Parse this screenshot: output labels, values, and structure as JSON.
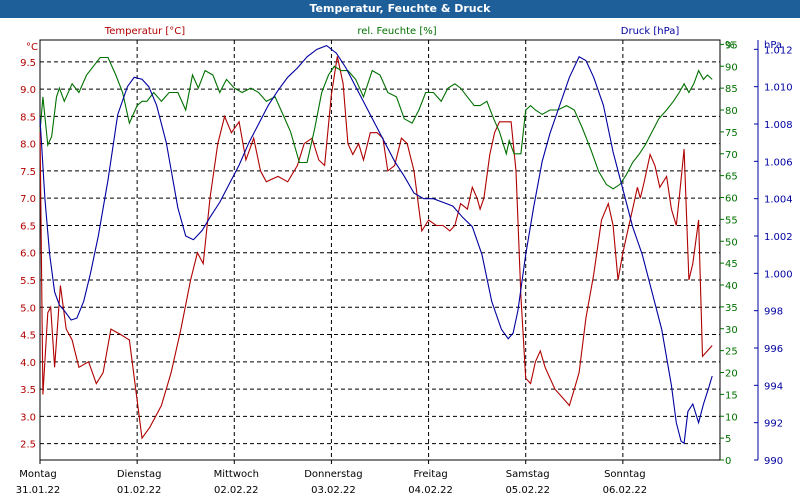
{
  "window_title": "Temperatur, Feuchte & Druck",
  "colors": {
    "temperature": "#b00000",
    "humidity": "#007000",
    "pressure": "#0000a0",
    "title_bg": "#1f5f99"
  },
  "chart_data": {
    "type": "line",
    "title": "Temperatur, Feuchte & Druck",
    "grid": true,
    "x_ticks": [
      {
        "day": "Montag",
        "date": "31.01.22"
      },
      {
        "day": "Dienstag",
        "date": "01.02.22"
      },
      {
        "day": "Mittwoch",
        "date": "02.02.22"
      },
      {
        "day": "Donnerstag",
        "date": "03.02.22"
      },
      {
        "day": "Freitag",
        "date": "04.02.22"
      },
      {
        "day": "Samstag",
        "date": "05.02.22"
      },
      {
        "day": "Sonntag",
        "date": "06.02.22"
      }
    ],
    "x_unit": "days since Montag 31.01.22 00:00",
    "axes": {
      "temperature": {
        "unit": "°C",
        "label": "Temperatur [°C]",
        "range": [
          2.2,
          9.9
        ],
        "ticks": [
          "2.5",
          "3.0",
          "3.5",
          "4.0",
          "4.5",
          "5.0",
          "5.5",
          "6.0",
          "6.5",
          "7.0",
          "7.5",
          "8.0",
          "8.5",
          "9.0",
          "9.5"
        ]
      },
      "humidity": {
        "unit": "%",
        "label": "rel. Feuchte [%]",
        "range": [
          0,
          96
        ],
        "ticks": [
          "0",
          "5",
          "10",
          "15",
          "20",
          "25",
          "30",
          "35",
          "40",
          "45",
          "50",
          "55",
          "60",
          "65",
          "70",
          "75",
          "80",
          "85",
          "90",
          "95"
        ]
      },
      "pressure": {
        "unit": "hPa",
        "label": "Druck [hPa]",
        "range": [
          990,
          1012.5
        ],
        "ticks": [
          "990",
          "992",
          "994",
          "996",
          "998",
          "1.000",
          "1.002",
          "1.004",
          "1.006",
          "1.008",
          "1.010",
          "1.012"
        ]
      }
    },
    "series": [
      {
        "name": "Temperatur [°C]",
        "axis": "temperature",
        "points": [
          [
            0,
            8.3
          ],
          [
            0.03,
            3.4
          ],
          [
            0.08,
            4.9
          ],
          [
            0.11,
            5.0
          ],
          [
            0.15,
            3.9
          ],
          [
            0.21,
            5.4
          ],
          [
            0.27,
            4.6
          ],
          [
            0.33,
            4.4
          ],
          [
            0.4,
            3.9
          ],
          [
            0.5,
            4.0
          ],
          [
            0.58,
            3.6
          ],
          [
            0.65,
            3.8
          ],
          [
            0.73,
            4.6
          ],
          [
            0.83,
            4.5
          ],
          [
            0.92,
            4.4
          ],
          [
            1.0,
            3.3
          ],
          [
            1.05,
            2.6
          ],
          [
            1.13,
            2.8
          ],
          [
            1.25,
            3.2
          ],
          [
            1.35,
            3.8
          ],
          [
            1.45,
            4.6
          ],
          [
            1.55,
            5.5
          ],
          [
            1.62,
            6.0
          ],
          [
            1.68,
            5.8
          ],
          [
            1.75,
            7.0
          ],
          [
            1.83,
            8.0
          ],
          [
            1.9,
            8.5
          ],
          [
            1.97,
            8.2
          ],
          [
            2.05,
            8.4
          ],
          [
            2.12,
            7.7
          ],
          [
            2.2,
            8.1
          ],
          [
            2.27,
            7.5
          ],
          [
            2.33,
            7.3
          ],
          [
            2.45,
            7.4
          ],
          [
            2.55,
            7.3
          ],
          [
            2.65,
            7.6
          ],
          [
            2.72,
            8.0
          ],
          [
            2.8,
            8.1
          ],
          [
            2.87,
            7.7
          ],
          [
            2.93,
            7.6
          ],
          [
            3.0,
            8.9
          ],
          [
            3.06,
            9.6
          ],
          [
            3.12,
            9.1
          ],
          [
            3.17,
            8.0
          ],
          [
            3.22,
            7.8
          ],
          [
            3.28,
            8.0
          ],
          [
            3.33,
            7.7
          ],
          [
            3.4,
            8.2
          ],
          [
            3.47,
            8.2
          ],
          [
            3.53,
            8.1
          ],
          [
            3.58,
            7.5
          ],
          [
            3.65,
            7.6
          ],
          [
            3.72,
            8.1
          ],
          [
            3.78,
            8.0
          ],
          [
            3.85,
            7.5
          ],
          [
            3.93,
            6.4
          ],
          [
            4.0,
            6.6
          ],
          [
            4.08,
            6.5
          ],
          [
            4.15,
            6.5
          ],
          [
            4.22,
            6.4
          ],
          [
            4.27,
            6.5
          ],
          [
            4.33,
            6.9
          ],
          [
            4.4,
            6.8
          ],
          [
            4.45,
            7.2
          ],
          [
            4.5,
            7.0
          ],
          [
            4.53,
            6.8
          ],
          [
            4.57,
            7.0
          ],
          [
            4.63,
            7.8
          ],
          [
            4.68,
            8.2
          ],
          [
            4.73,
            8.4
          ],
          [
            4.78,
            8.4
          ],
          [
            4.85,
            8.4
          ],
          [
            4.9,
            7.5
          ],
          [
            4.95,
            5.2
          ],
          [
            5.0,
            3.7
          ],
          [
            5.05,
            3.6
          ],
          [
            5.1,
            4.0
          ],
          [
            5.15,
            4.2
          ],
          [
            5.2,
            3.9
          ],
          [
            5.3,
            3.5
          ],
          [
            5.4,
            3.3
          ],
          [
            5.45,
            3.2
          ],
          [
            5.5,
            3.5
          ],
          [
            5.55,
            3.8
          ],
          [
            5.62,
            4.8
          ],
          [
            5.7,
            5.6
          ],
          [
            5.78,
            6.6
          ],
          [
            5.85,
            6.9
          ],
          [
            5.9,
            6.5
          ],
          [
            5.95,
            5.5
          ],
          [
            6.0,
            6.0
          ],
          [
            6.05,
            6.4
          ],
          [
            6.1,
            6.8
          ],
          [
            6.15,
            7.2
          ],
          [
            6.18,
            7.0
          ],
          [
            6.22,
            7.3
          ],
          [
            6.28,
            7.8
          ],
          [
            6.33,
            7.6
          ],
          [
            6.38,
            7.2
          ],
          [
            6.45,
            7.4
          ],
          [
            6.5,
            6.8
          ],
          [
            6.55,
            6.5
          ],
          [
            6.58,
            7.0
          ],
          [
            6.63,
            7.9
          ],
          [
            6.68,
            5.5
          ],
          [
            6.72,
            5.8
          ],
          [
            6.78,
            6.6
          ],
          [
            6.82,
            4.1
          ],
          [
            6.87,
            4.2
          ],
          [
            6.92,
            4.3
          ]
        ]
      },
      {
        "name": "rel. Feuchte [%]",
        "axis": "humidity",
        "points": [
          [
            0,
            75
          ],
          [
            0.03,
            83
          ],
          [
            0.08,
            72
          ],
          [
            0.12,
            74
          ],
          [
            0.17,
            83
          ],
          [
            0.2,
            85
          ],
          [
            0.25,
            82
          ],
          [
            0.33,
            86
          ],
          [
            0.4,
            84
          ],
          [
            0.48,
            88
          ],
          [
            0.55,
            90
          ],
          [
            0.62,
            92
          ],
          [
            0.7,
            92
          ],
          [
            0.78,
            88
          ],
          [
            0.85,
            84
          ],
          [
            0.92,
            77
          ],
          [
            1.0,
            81
          ],
          [
            1.05,
            82
          ],
          [
            1.1,
            82
          ],
          [
            1.17,
            84
          ],
          [
            1.25,
            82
          ],
          [
            1.33,
            84
          ],
          [
            1.42,
            84
          ],
          [
            1.5,
            80
          ],
          [
            1.57,
            88
          ],
          [
            1.63,
            85
          ],
          [
            1.7,
            89
          ],
          [
            1.78,
            88
          ],
          [
            1.85,
            84
          ],
          [
            1.92,
            87
          ],
          [
            2.0,
            85
          ],
          [
            2.08,
            84
          ],
          [
            2.17,
            85
          ],
          [
            2.25,
            84
          ],
          [
            2.33,
            82
          ],
          [
            2.42,
            83
          ],
          [
            2.5,
            79
          ],
          [
            2.58,
            75
          ],
          [
            2.67,
            68
          ],
          [
            2.75,
            68
          ],
          [
            2.83,
            76
          ],
          [
            2.9,
            84
          ],
          [
            2.97,
            88
          ],
          [
            3.03,
            90
          ],
          [
            3.1,
            89
          ],
          [
            3.17,
            89
          ],
          [
            3.25,
            87
          ],
          [
            3.33,
            83
          ],
          [
            3.42,
            89
          ],
          [
            3.5,
            88
          ],
          [
            3.58,
            84
          ],
          [
            3.67,
            83
          ],
          [
            3.75,
            78
          ],
          [
            3.83,
            77
          ],
          [
            3.9,
            80
          ],
          [
            3.97,
            84
          ],
          [
            4.05,
            84
          ],
          [
            4.13,
            82
          ],
          [
            4.2,
            85
          ],
          [
            4.27,
            86
          ],
          [
            4.33,
            85
          ],
          [
            4.4,
            83
          ],
          [
            4.47,
            81
          ],
          [
            4.53,
            81
          ],
          [
            4.6,
            82
          ],
          [
            4.67,
            78
          ],
          [
            4.73,
            75
          ],
          [
            4.8,
            70
          ],
          [
            4.83,
            73
          ],
          [
            4.88,
            70
          ],
          [
            4.95,
            70
          ],
          [
            5.0,
            80
          ],
          [
            5.05,
            81
          ],
          [
            5.1,
            80
          ],
          [
            5.17,
            79
          ],
          [
            5.25,
            80
          ],
          [
            5.33,
            80
          ],
          [
            5.42,
            81
          ],
          [
            5.5,
            80
          ],
          [
            5.58,
            76
          ],
          [
            5.67,
            71
          ],
          [
            5.75,
            66
          ],
          [
            5.83,
            63
          ],
          [
            5.9,
            62
          ],
          [
            5.97,
            63
          ],
          [
            6.03,
            65
          ],
          [
            6.1,
            68
          ],
          [
            6.17,
            70
          ],
          [
            6.23,
            72
          ],
          [
            6.3,
            75
          ],
          [
            6.37,
            78
          ],
          [
            6.45,
            80
          ],
          [
            6.52,
            82
          ],
          [
            6.58,
            84
          ],
          [
            6.63,
            86
          ],
          [
            6.68,
            84
          ],
          [
            6.73,
            86
          ],
          [
            6.78,
            89
          ],
          [
            6.83,
            87
          ],
          [
            6.87,
            88
          ],
          [
            6.92,
            87
          ]
        ]
      },
      {
        "name": "Druck [hPa]",
        "axis": "pressure",
        "points": [
          [
            0,
            1008.3
          ],
          [
            0.05,
            1004.0
          ],
          [
            0.1,
            1001.0
          ],
          [
            0.15,
            999.0
          ],
          [
            0.2,
            998.3
          ],
          [
            0.25,
            998.0
          ],
          [
            0.32,
            997.5
          ],
          [
            0.38,
            997.6
          ],
          [
            0.45,
            998.5
          ],
          [
            0.52,
            1000.0
          ],
          [
            0.6,
            1002.0
          ],
          [
            0.7,
            1005.0
          ],
          [
            0.8,
            1008.5
          ],
          [
            0.9,
            1010.0
          ],
          [
            0.97,
            1010.5
          ],
          [
            1.05,
            1010.4
          ],
          [
            1.12,
            1010.0
          ],
          [
            1.2,
            1009.0
          ],
          [
            1.3,
            1007.0
          ],
          [
            1.42,
            1003.5
          ],
          [
            1.5,
            1002.0
          ],
          [
            1.58,
            1001.8
          ],
          [
            1.67,
            1002.3
          ],
          [
            1.75,
            1003.0
          ],
          [
            1.85,
            1003.8
          ],
          [
            1.95,
            1004.8
          ],
          [
            2.05,
            1005.8
          ],
          [
            2.15,
            1007.0
          ],
          [
            2.25,
            1008.0
          ],
          [
            2.35,
            1009.0
          ],
          [
            2.45,
            1009.8
          ],
          [
            2.55,
            1010.5
          ],
          [
            2.65,
            1011.0
          ],
          [
            2.75,
            1011.6
          ],
          [
            2.85,
            1012.0
          ],
          [
            2.95,
            1012.2
          ],
          [
            3.05,
            1011.8
          ],
          [
            3.15,
            1011.0
          ],
          [
            3.25,
            1010.0
          ],
          [
            3.35,
            1009.0
          ],
          [
            3.45,
            1008.0
          ],
          [
            3.55,
            1007.0
          ],
          [
            3.65,
            1006.0
          ],
          [
            3.75,
            1005.2
          ],
          [
            3.85,
            1004.3
          ],
          [
            3.95,
            1004.0
          ],
          [
            4.05,
            1004.0
          ],
          [
            4.15,
            1003.8
          ],
          [
            4.25,
            1003.6
          ],
          [
            4.35,
            1003.0
          ],
          [
            4.45,
            1002.5
          ],
          [
            4.55,
            1001.0
          ],
          [
            4.65,
            998.5
          ],
          [
            4.75,
            997.0
          ],
          [
            4.82,
            996.5
          ],
          [
            4.87,
            996.8
          ],
          [
            4.92,
            998.0
          ],
          [
            5.0,
            1001.0
          ],
          [
            5.08,
            1003.5
          ],
          [
            5.17,
            1006.0
          ],
          [
            5.25,
            1007.5
          ],
          [
            5.35,
            1009.0
          ],
          [
            5.45,
            1010.5
          ],
          [
            5.55,
            1011.6
          ],
          [
            5.62,
            1011.4
          ],
          [
            5.7,
            1010.5
          ],
          [
            5.8,
            1009.0
          ],
          [
            5.9,
            1006.5
          ],
          [
            6.0,
            1004.5
          ],
          [
            6.1,
            1002.5
          ],
          [
            6.2,
            1001.0
          ],
          [
            6.3,
            999.0
          ],
          [
            6.4,
            997.0
          ],
          [
            6.5,
            994.0
          ],
          [
            6.55,
            992.0
          ],
          [
            6.6,
            991.0
          ],
          [
            6.63,
            990.9
          ],
          [
            6.67,
            992.6
          ],
          [
            6.72,
            993.0
          ],
          [
            6.78,
            992.0
          ],
          [
            6.83,
            993.0
          ],
          [
            6.88,
            993.8
          ],
          [
            6.92,
            994.5
          ]
        ]
      }
    ]
  }
}
